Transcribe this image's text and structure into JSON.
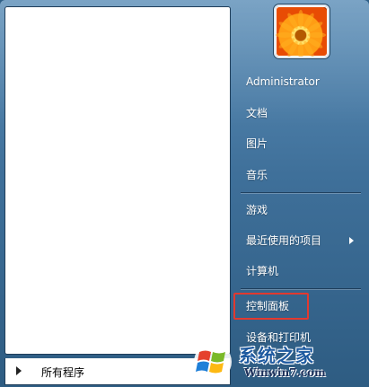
{
  "user": {
    "name": "Administrator"
  },
  "all_programs_label": "所有程序",
  "right_items": [
    {
      "label": "文档"
    },
    {
      "label": "图片"
    },
    {
      "label": "音乐"
    },
    {
      "label": "游戏"
    },
    {
      "label": "最近使用的项目"
    },
    {
      "label": "计算机"
    },
    {
      "label": "控制面板"
    },
    {
      "label": "设备和打印机"
    }
  ],
  "watermark": {
    "title": "系统之家",
    "url": "Winwin7.com"
  },
  "colors": {
    "highlight": "#e2392f",
    "panel_gradient_top": "#5d8fb8",
    "panel_gradient_bottom": "#2e5c82"
  },
  "icons": {
    "avatar": "flower-avatar-icon",
    "submenu": "chevron-right-icon",
    "all_programs": "triangle-right-icon",
    "watermark_logo": "windows-flag-logo"
  }
}
